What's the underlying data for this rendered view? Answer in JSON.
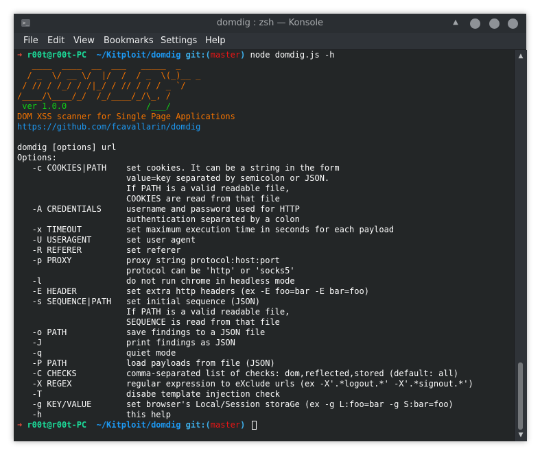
{
  "window": {
    "title": "domdig : zsh — Konsole",
    "app_icon_glyph": ">_"
  },
  "menu": [
    "File",
    "Edit",
    "View",
    "Bookmarks",
    "Settings",
    "Help"
  ],
  "colors": {
    "prompt_arrow": "#e74c3c",
    "prompt_user": "#1cdc9a",
    "prompt_path": "#1d99f3",
    "git_label": "#3daee9",
    "git_branch": "#ed1515",
    "banner_orange": "#f67400",
    "banner_green": "#11d116",
    "link_blue": "#1d99f3",
    "text": "#fcfcfc"
  },
  "terminal_lines": [
    [
      {
        "t": "➜ ",
        "c": "prompt_arrow"
      },
      {
        "t": "r00t@r00t-PC ",
        "c": "prompt_user",
        "b": true
      },
      {
        "t": " ~/Kitploit/domdig ",
        "c": "prompt_path",
        "b": true
      },
      {
        "t": "git:(",
        "c": "git_label",
        "b": true
      },
      {
        "t": "master",
        "c": "git_branch"
      },
      {
        "t": ")",
        "c": "git_label",
        "b": true
      },
      {
        "t": " node domdig.js -h",
        "c": "text"
      }
    ],
    [
      {
        "t": "   ____  ____  __  ___   _____  _",
        "c": "banner_orange"
      }
    ],
    [
      {
        "t": "  / _  \\/ __ \\/  |/  /  / _  \\(_)__ _",
        "c": "banner_orange"
      }
    ],
    [
      {
        "t": " / // / /_/ / /|_/ / // / / / _ `/",
        "c": "banner_orange"
      }
    ],
    [
      {
        "t": "/____/\\____/_/  /_/____/_/\\_, /",
        "c": "banner_orange"
      }
    ],
    [
      {
        "t": " ver 1.0.0                /___/",
        "c": "banner_green"
      }
    ],
    [
      {
        "t": "DOM XSS scanner for Single Page Applications",
        "c": "banner_orange"
      }
    ],
    [
      {
        "t": "https://github.com/fcavallarin/domdig",
        "c": "link_blue"
      }
    ],
    [
      {
        "t": "",
        "c": "text"
      }
    ],
    [
      {
        "t": "domdig [options] url",
        "c": "text"
      }
    ],
    [
      {
        "t": "Options:",
        "c": "text"
      }
    ],
    [
      {
        "t": "   -c COOKIES|PATH    set cookies. It can be a string in the form",
        "c": "text"
      }
    ],
    [
      {
        "t": "                      value=key separated by semicolon or JSON.",
        "c": "text"
      }
    ],
    [
      {
        "t": "                      If PATH is a valid readable file,",
        "c": "text"
      }
    ],
    [
      {
        "t": "                      COOKIES are read from that file",
        "c": "text"
      }
    ],
    [
      {
        "t": "   -A CREDENTIALS     username and password used for HTTP",
        "c": "text"
      }
    ],
    [
      {
        "t": "                      authentication separated by a colon",
        "c": "text"
      }
    ],
    [
      {
        "t": "   -x TIMEOUT         set maximum execution time in seconds for each payload",
        "c": "text"
      }
    ],
    [
      {
        "t": "   -U USERAGENT       set user agent",
        "c": "text"
      }
    ],
    [
      {
        "t": "   -R REFERER         set referer",
        "c": "text"
      }
    ],
    [
      {
        "t": "   -p PROXY           proxy string protocol:host:port",
        "c": "text"
      }
    ],
    [
      {
        "t": "                      protocol can be 'http' or 'socks5'",
        "c": "text"
      }
    ],
    [
      {
        "t": "   -l                 do not run chrome in headless mode",
        "c": "text"
      }
    ],
    [
      {
        "t": "   -E HEADER          set extra http headers (ex -E foo=bar -E bar=foo)",
        "c": "text"
      }
    ],
    [
      {
        "t": "   -s SEQUENCE|PATH   set initial sequence (JSON)",
        "c": "text"
      }
    ],
    [
      {
        "t": "                      If PATH is a valid readable file,",
        "c": "text"
      }
    ],
    [
      {
        "t": "                      SEQUENCE is read from that file",
        "c": "text"
      }
    ],
    [
      {
        "t": "   -o PATH            save findings to a JSON file",
        "c": "text"
      }
    ],
    [
      {
        "t": "   -J                 print findings as JSON",
        "c": "text"
      }
    ],
    [
      {
        "t": "   -q                 quiet mode",
        "c": "text"
      }
    ],
    [
      {
        "t": "   -P PATH            load payloads from file (JSON)",
        "c": "text"
      }
    ],
    [
      {
        "t": "   -C CHECKS          comma-separated list of checks: dom,reflected,stored (default: all)",
        "c": "text"
      }
    ],
    [
      {
        "t": "   -X REGEX           regular expression to eXclude urls (ex -X'.*logout.*' -X'.*signout.*')",
        "c": "text"
      }
    ],
    [
      {
        "t": "   -T                 disabe template injection check",
        "c": "text"
      }
    ],
    [
      {
        "t": "   -g KEY/VALUE       set browser's Local/Session storaGe (ex -g L:foo=bar -g S:bar=foo)",
        "c": "text"
      }
    ],
    [
      {
        "t": "   -h                 this help",
        "c": "text"
      }
    ],
    [
      {
        "t": "➜ ",
        "c": "prompt_arrow"
      },
      {
        "t": "r00t@r00t-PC ",
        "c": "prompt_user",
        "b": true
      },
      {
        "t": " ~/Kitploit/domdig ",
        "c": "prompt_path",
        "b": true
      },
      {
        "t": "git:(",
        "c": "git_label",
        "b": true
      },
      {
        "t": "master",
        "c": "git_branch"
      },
      {
        "t": ")",
        "c": "git_label",
        "b": true
      },
      {
        "t": " ",
        "c": "text"
      }
    ]
  ],
  "scrollbar": {
    "up_glyph": "▲",
    "down_glyph": "▼"
  },
  "titlebar_buttons": {
    "keep_above_glyph": "▲",
    "names": [
      "minimize",
      "maximize",
      "close"
    ]
  }
}
